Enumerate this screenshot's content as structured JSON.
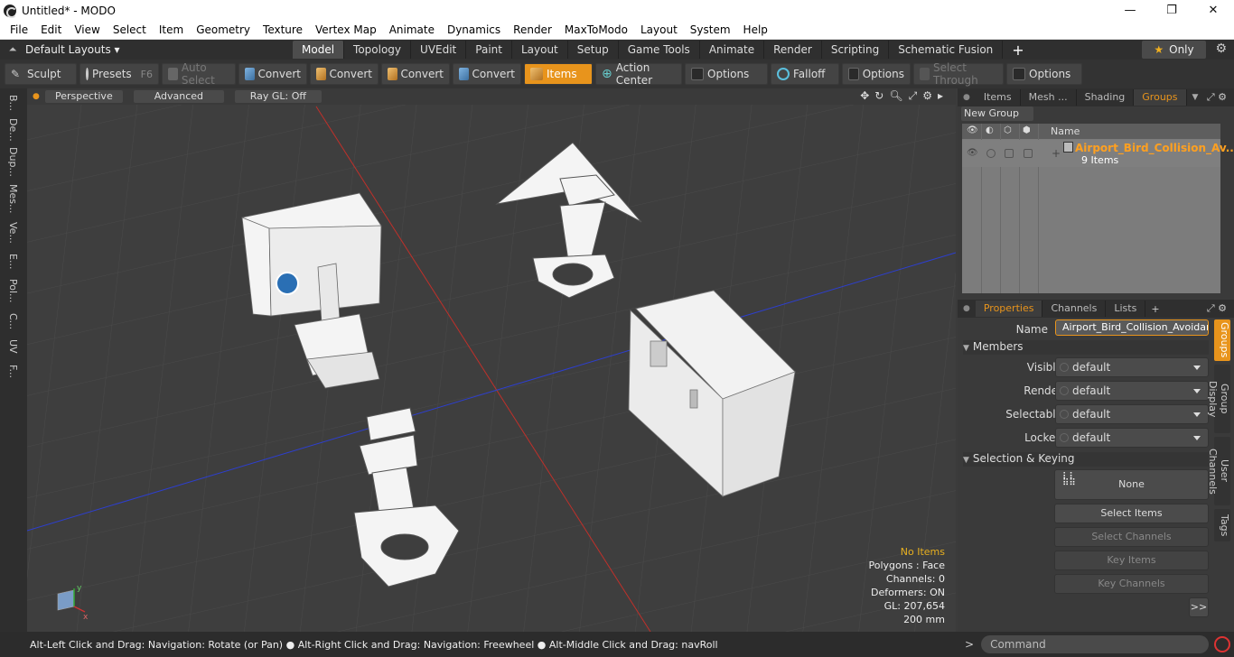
{
  "window": {
    "title": "Untitled* - MODO",
    "min": "—",
    "max": "❐",
    "close": "✕"
  },
  "menu": [
    "File",
    "Edit",
    "View",
    "Select",
    "Item",
    "Geometry",
    "Texture",
    "Vertex Map",
    "Animate",
    "Dynamics",
    "Render",
    "MaxToModo",
    "Layout",
    "System",
    "Help"
  ],
  "layoutbar": {
    "selector": "Default Layouts ▾",
    "tabs": [
      "Model",
      "Topology",
      "UVEdit",
      "Paint",
      "Layout",
      "Setup",
      "Game Tools",
      "Animate",
      "Render",
      "Scripting",
      "Schematic Fusion"
    ],
    "active_tab": "Model",
    "plus": "+",
    "only": "Only"
  },
  "toolbar": {
    "sculpt": "Sculpt",
    "presets": "Presets",
    "presets_key": "F6",
    "auto_select": "Auto Select",
    "convert1": "Convert",
    "convert2": "Convert",
    "convert3": "Convert",
    "convert4": "Convert",
    "items": "Items",
    "action_center": "Action Center",
    "options1": "Options",
    "falloff": "Falloff",
    "options2": "Options",
    "select_through": "Select Through",
    "options3": "Options"
  },
  "left_tabs": [
    "B...",
    "De...",
    "Dup...",
    "Mes...",
    "Ve...",
    "E...",
    "Pol...",
    "C...",
    "UV",
    "F..."
  ],
  "viewport": {
    "perspective": "Perspective",
    "advanced": "Advanced",
    "raygl": "Ray GL: Off",
    "info": {
      "no_items": "No Items",
      "polygons": "Polygons : Face",
      "channels": "Channels: 0",
      "deformers": "Deformers: ON",
      "gl": "GL: 207,654",
      "scale": "200 mm"
    },
    "axis_labels": {
      "y": "y",
      "x": "x"
    }
  },
  "status": "Alt-Left Click and Drag: Navigation: Rotate (or Pan) ● Alt-Right Click and Drag: Navigation: Freewheel ● Alt-Middle Click and Drag: navRoll",
  "groups_panel": {
    "tabs": [
      "Items",
      "Mesh ...",
      "Shading",
      "Groups"
    ],
    "active_tab": "Groups",
    "new_group": "New Group",
    "column_name": "Name",
    "group_name": "Airport_Bird_Collision_Av...",
    "group_count": "9 Items"
  },
  "properties_panel": {
    "tabs": [
      "Properties",
      "Channels",
      "Lists"
    ],
    "active_tab": "Properties",
    "name_label": "Name",
    "name_value": "Airport_Bird_Collision_Avoidance",
    "members_section": "Members",
    "visible_label": "Visible",
    "visible_value": "default",
    "render_label": "Render",
    "render_value": "default",
    "selectable_label": "Selectable",
    "selectable_value": "default",
    "locked_label": "Locked",
    "locked_value": "default",
    "selkey_section": "Selection & Keying",
    "none_btn": "None",
    "select_items": "Select Items",
    "select_channels": "Select Channels",
    "key_items": "Key Items",
    "key_channels": "Key Channels",
    "more": ">>"
  },
  "side_vtabs": [
    "Groups",
    "Group Display",
    "User Channels",
    "Tags"
  ],
  "command": {
    "prompt": ">",
    "placeholder": "Command"
  },
  "colors": {
    "accent": "#e8941c",
    "viewport_bg": "#3e3e3e",
    "x_axis": "#c0302a",
    "z_axis": "#2d3fd0"
  }
}
